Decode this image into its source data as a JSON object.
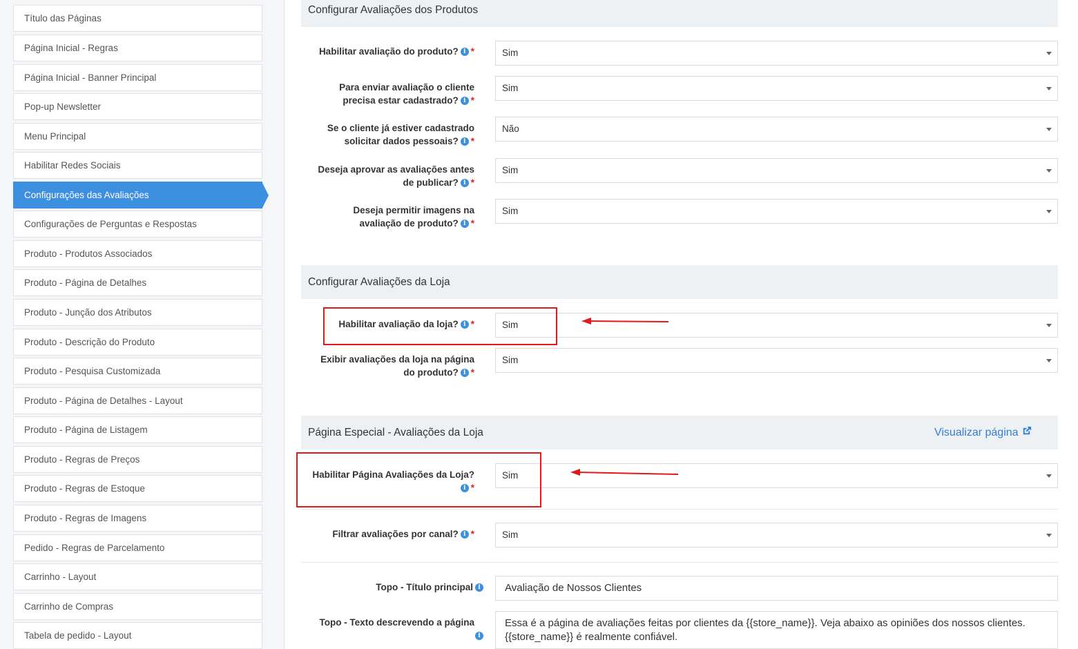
{
  "sidebar": {
    "items": [
      {
        "label": "Título das Páginas"
      },
      {
        "label": "Página Inicial - Regras"
      },
      {
        "label": "Página Inicial - Banner Principal"
      },
      {
        "label": "Pop-up Newsletter"
      },
      {
        "label": "Menu Principal"
      },
      {
        "label": "Habilitar Redes Sociais"
      },
      {
        "label": "Configurações das Avaliações",
        "active": true
      },
      {
        "label": "Configurações de Perguntas e Respostas"
      },
      {
        "label": "Produto - Produtos Associados"
      },
      {
        "label": "Produto - Página de Detalhes"
      },
      {
        "label": "Produto - Junção dos Atributos"
      },
      {
        "label": "Produto - Descrição do Produto"
      },
      {
        "label": "Produto - Pesquisa Customizada"
      },
      {
        "label": "Produto - Página de Detalhes - Layout"
      },
      {
        "label": "Produto - Página de Listagem"
      },
      {
        "label": "Produto - Regras de Preços"
      },
      {
        "label": "Produto - Regras de Estoque"
      },
      {
        "label": "Produto - Regras de Imagens"
      },
      {
        "label": "Pedido - Regras de Parcelamento"
      },
      {
        "label": "Carrinho - Layout"
      },
      {
        "label": "Carrinho de Compras"
      },
      {
        "label": "Tabela de pedido - Layout"
      }
    ]
  },
  "sections": {
    "product_reviews": {
      "title": "Configurar Avaliações dos Produtos",
      "fields": [
        {
          "label": [
            "Habilitar avaliação do produto?"
          ],
          "value": "Sim"
        },
        {
          "label": [
            "Para enviar avaliação o cliente",
            "precisa estar cadastrado?"
          ],
          "value": "Sim"
        },
        {
          "label": [
            "Se o cliente já estiver cadastrado",
            "solicitar dados pessoais?"
          ],
          "value": "Não"
        },
        {
          "label": [
            "Deseja aprovar as avaliações antes",
            "de publicar?"
          ],
          "value": "Sim"
        },
        {
          "label": [
            "Deseja permitir imagens na",
            "avaliação de produto?"
          ],
          "value": "Sim"
        }
      ]
    },
    "store_reviews": {
      "title": "Configurar Avaliações da Loja",
      "fields": [
        {
          "label": [
            "Habilitar avaliação da loja?"
          ],
          "value": "Sim"
        },
        {
          "label": [
            "Exibir avaliações da loja na página",
            "do produto?"
          ],
          "value": "Sim"
        }
      ]
    },
    "special_page": {
      "title": "Página Especial - Avaliações da Loja",
      "link": "Visualizar página",
      "fields": [
        {
          "label": [
            "Habilitar Página Avaliações da Loja?"
          ],
          "value": "Sim"
        },
        {
          "label": [
            "Filtrar avaliações por canal?"
          ],
          "value": "Sim"
        },
        {
          "label": [
            "Topo - Título principal"
          ],
          "value": "Avaliação de Nossos Clientes"
        },
        {
          "label": [
            "Topo - Texto descrevendo a página"
          ],
          "value": "Essa é a página de avaliações feitas por clientes da {{store_name}}. Veja abaixo as opiniões dos nossos clientes. {{store_name}} é realmente confiável."
        }
      ]
    }
  },
  "icons": {
    "info": "info-icon",
    "required": "*",
    "external_link": "external-link-icon"
  },
  "colors": {
    "accent": "#3d8fe0",
    "highlight": "#e0191b",
    "link": "#2f7fd4"
  }
}
